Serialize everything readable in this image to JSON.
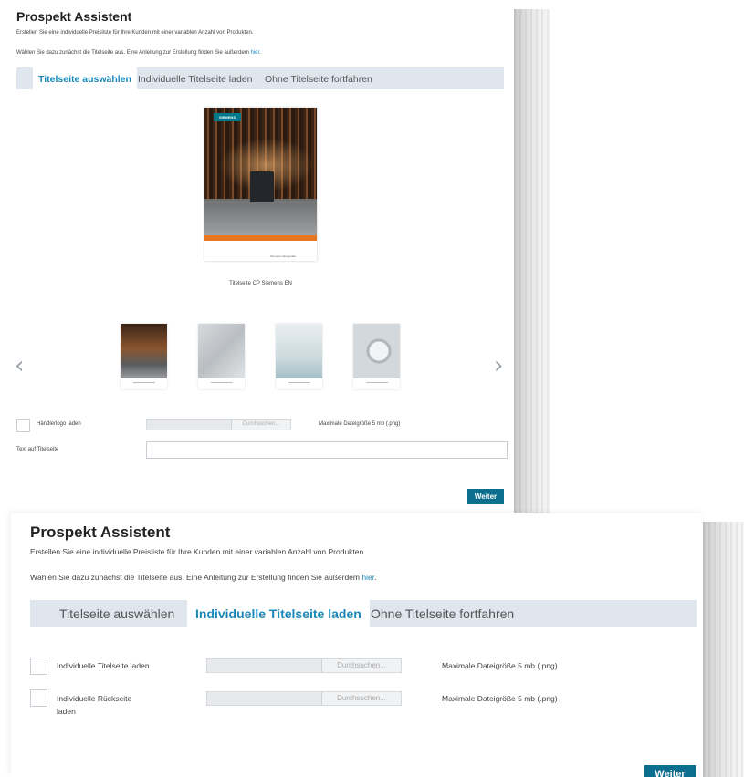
{
  "panel1": {
    "title": "Prospekt Assistent",
    "intro": "Erstellen Sie eine individuelle Preisliste für Ihre Kunden mit einer variablen Anzahl von Produkten.",
    "instruction": "Wählen Sie dazu zunächst die Titelseite aus. Eine Anleitung zur Erstellung finden Sie außerdem",
    "instruction_link": "hier",
    "tabs": [
      {
        "label": "Titelseite auswählen",
        "active": true
      },
      {
        "label": "Individuelle Titelseite laden",
        "active": false
      },
      {
        "label": "Ohne Titelseite fortfahren",
        "active": false
      }
    ],
    "cover_logo": "SIEMENS",
    "cover_footer": "Siemens Hausgeräte",
    "cover_caption": "Titelseite CP Siemens EN",
    "prev_arrow": "‹",
    "next_arrow": "›",
    "logo_checkbox_label": "Händlerlogo laden",
    "browse_label": "Durchsuchen...",
    "max_size": "Maximale Dateigröße 5 mb (.png)",
    "cover_text_label": "Text auf Titelseite",
    "cover_text_value": "",
    "next_button": "Weiter"
  },
  "panel2": {
    "title": "Prospekt Assistent",
    "intro": "Erstellen Sie eine individuelle Preisliste für Ihre Kunden mit einer variablen Anzahl von Produkten.",
    "instruction": "Wählen Sie dazu zunächst die Titelseite aus. Eine Anleitung zur Erstellung finden Sie außerdem",
    "instruction_link": "hier",
    "tabs": [
      {
        "label": "Titelseite auswählen",
        "active": false
      },
      {
        "label": "Individuelle Titelseite laden",
        "active": true
      },
      {
        "label": "Ohne Titelseite fortfahren",
        "active": false
      }
    ],
    "rows": [
      {
        "label": "Individuelle Titelseite laden",
        "browse": "Durchsuchen...",
        "max_size": "Maximale Dateigröße 5 mb (.png)"
      },
      {
        "label": "Individuelle Rückseite laden",
        "browse": "Durchsuchen...",
        "max_size": "Maximale Dateigröße 5 mb (.png)"
      }
    ],
    "next_button": "Weiter"
  },
  "colors": {
    "accent": "#1a88b8",
    "button": "#0b6e8e",
    "tab_bar": "#dfe6ee",
    "cover_band": "#e87722",
    "brand": "#007a8a"
  }
}
